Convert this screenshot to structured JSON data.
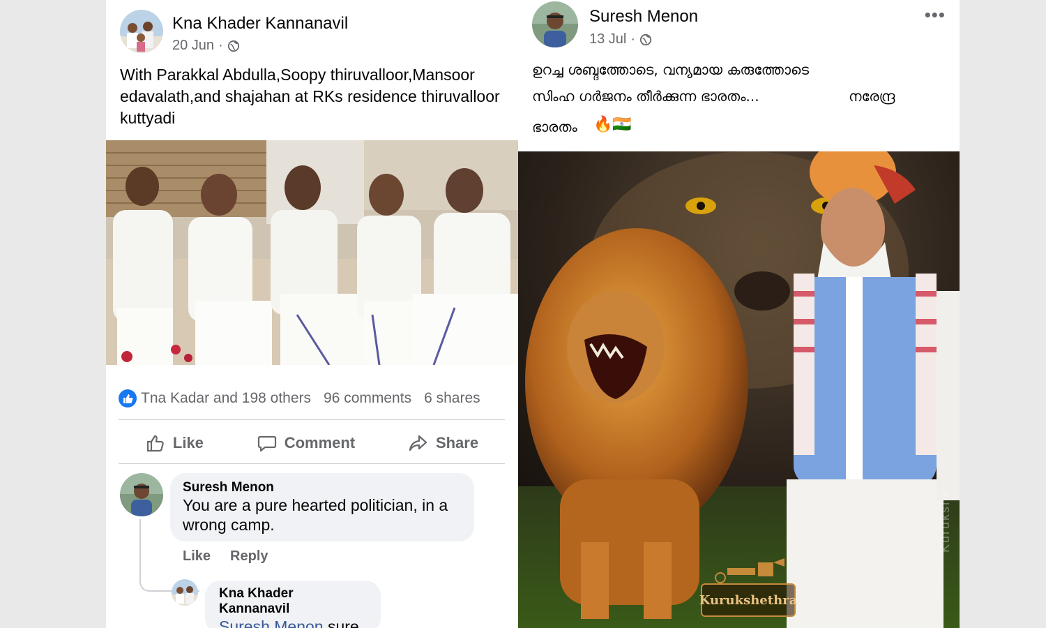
{
  "left_post": {
    "author": "Kna Khader Kannanavil",
    "date": "20 Jun",
    "separator": "·",
    "text": "With Parakkal Abdulla,Soopy thiruvalloor,Mansoor edavalath,and shajahan at RKs residence thiruvalloor kuttyadi",
    "reactions": "Tna Kadar and 198 others",
    "comments_count": "96 comments",
    "shares_count": "6 shares",
    "actions": {
      "like": "Like",
      "comment": "Comment",
      "share": "Share"
    },
    "comment": {
      "author": "Suresh Menon",
      "text": "You are a pure hearted politician, in a wrong camp.",
      "like_label": "Like",
      "reply_label": "Reply"
    },
    "reply": {
      "author": "Kna Khader Kannanavil",
      "mention": "Suresh Menon",
      "text": " sure"
    }
  },
  "right_post": {
    "author": "Suresh Menon",
    "date": "13 Jul",
    "separator": "·",
    "more": "•••",
    "line1": "ഉറച്ച ശബ്ദത്തോടെ, വന്യമായ കരുത്തോടെ",
    "line2": "സിംഹ ഗർജനം തീർക്കുന്ന ഭാരതം...",
    "line2_right": "നരേന്ദ്ര",
    "line3": "ഭാരതം",
    "emoji": "🔥🇮🇳",
    "image_badge": "Kurukshethra",
    "watermark": "Kurukshe"
  },
  "colors": {
    "facebook_blue": "#1877f2",
    "secondary_text": "#65676b",
    "comment_bg": "#f0f2f5"
  }
}
